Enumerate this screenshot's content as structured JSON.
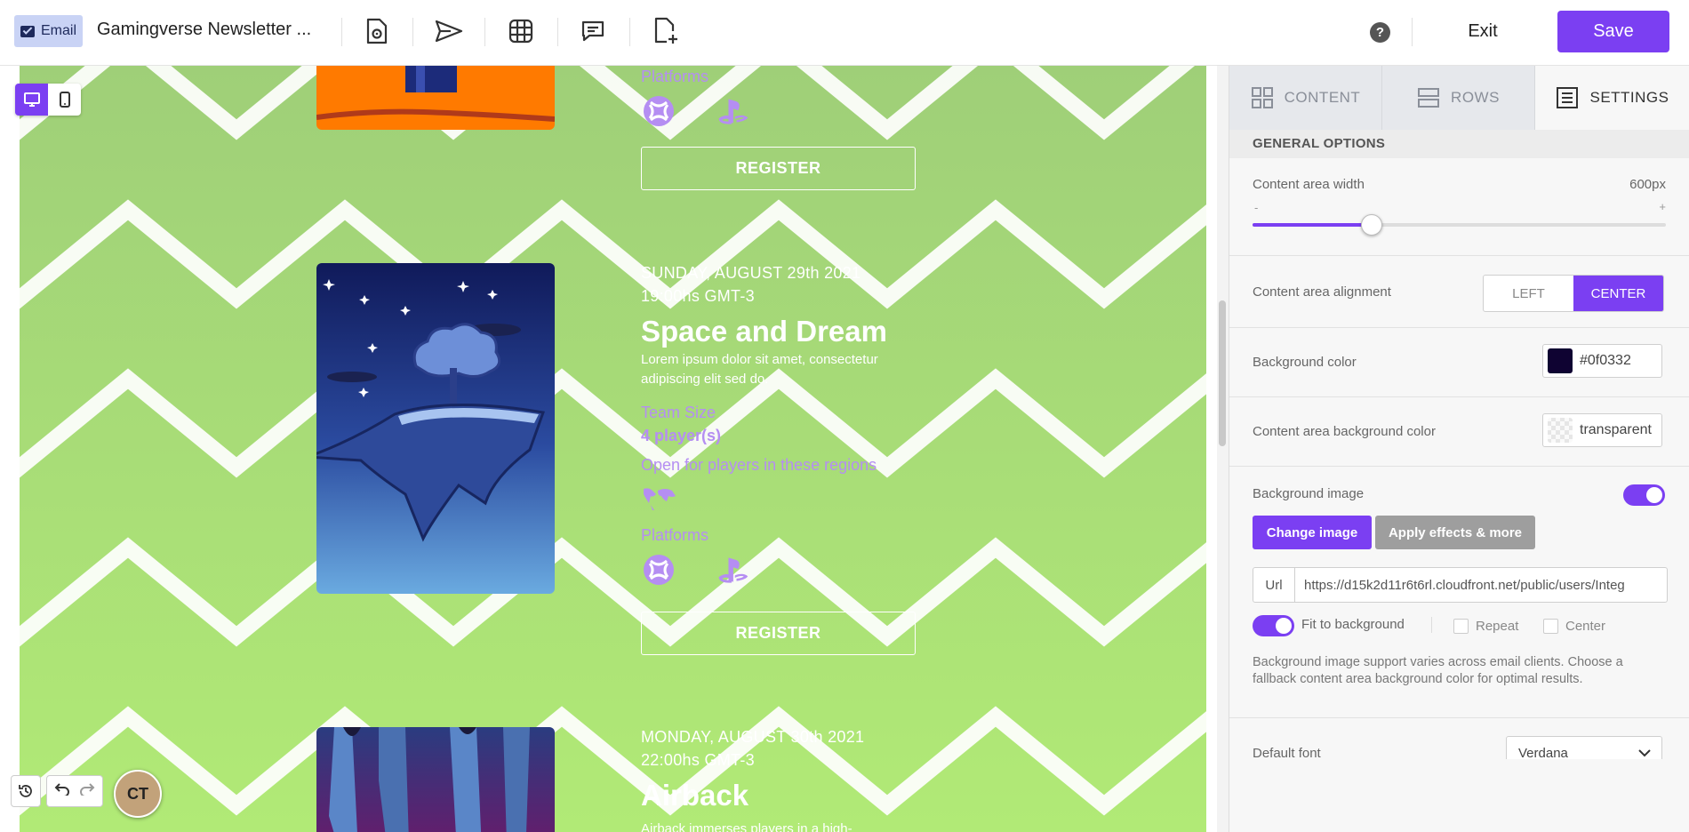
{
  "header": {
    "email_chip_label": "Email",
    "document_title": "Gamingverse Newsletter ...",
    "help_label": "?",
    "exit_label": "Exit",
    "save_label": "Save"
  },
  "canvas": {
    "events": [
      {
        "platforms_label": "Platforms",
        "register_label": "REGISTER"
      },
      {
        "date": "SUNDAY, AUGUST 29th 2021",
        "time": "19:00hs GMT-3",
        "title": "Space and Dream",
        "description": "Lorem ipsum dolor sit amet, consectetur adipiscing elit sed do.",
        "team_size_label": "Team Size",
        "team_size_value": "4 player(s)",
        "regions_label": "Open for players in these regions",
        "platforms_label": "Platforms",
        "register_label": "REGISTER"
      },
      {
        "date": "MONDAY, AUGUST 30th 2021",
        "time": "22:00hs GMT-3",
        "title": "Airback",
        "description": "Airback immerses players in a high-"
      }
    ]
  },
  "panel": {
    "tabs": [
      {
        "label": "CONTENT",
        "icon": "grid-icon"
      },
      {
        "label": "ROWS",
        "icon": "rows-icon"
      },
      {
        "label": "SETTINGS",
        "icon": "settings-icon"
      }
    ],
    "section_title": "GENERAL OPTIONS",
    "content_width": {
      "label": "Content area width",
      "value": "600px",
      "min_label": "-",
      "max_label": "+",
      "slider_fraction": 0.25
    },
    "alignment": {
      "label": "Content area alignment",
      "options": [
        "LEFT",
        "CENTER"
      ],
      "selected": "CENTER"
    },
    "background_color": {
      "label": "Background color",
      "value": "#0f0332"
    },
    "content_bg_color": {
      "label": "Content area background color",
      "value": "transparent"
    },
    "background_image": {
      "label": "Background image",
      "change_label": "Change image",
      "effects_label": "Apply effects & more",
      "url_label": "Url",
      "url_value": "https://d15k2d11r6t6rl.cloudfront.net/public/users/Integ",
      "fit_label": "Fit to background",
      "repeat_label": "Repeat",
      "center_label": "Center",
      "note": "Background image support varies across email clients. Choose a fallback content area background color for optimal results."
    },
    "default_font": {
      "label": "Default font",
      "value": "Verdana"
    }
  },
  "footer": {
    "avatar_initials": "CT"
  },
  "colors": {
    "accent": "#7b3ff2",
    "canvas_bg": "#a3d47a",
    "event_purple": "#b58ef2"
  }
}
